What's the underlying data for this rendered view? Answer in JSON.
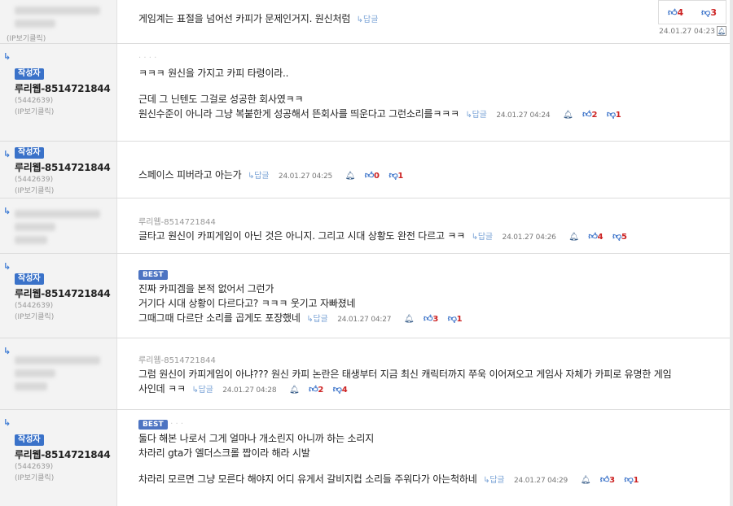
{
  "rows": [
    {
      "ip_label": "(IP보기클릭)",
      "text": "게임계는 표절을 넘어선 카피가 문제인거지. 원신처럼",
      "reply_label": "↳답글",
      "up": "4",
      "down": "3",
      "time": "24.01.27 04:23"
    },
    {
      "badge": "작성자",
      "name": "루리웹-8514721844",
      "uid": "(5442639)",
      "ip_label": "(IP보기클릭)",
      "lines": [
        "ㅋㅋㅋ 원신을 가지고 카피 타령이라..",
        "",
        "근데 그 닌텐도 그걸로 성공한 회사였ㅋㅋ",
        "원신수준이 아니라 그냥 복붙한게 성공해서 뜬회사를 띄운다고 그런소리를ㅋㅋㅋ"
      ],
      "reply_label": "↳답글",
      "time": "24.01.27 04:24",
      "up": "2",
      "down": "1"
    },
    {
      "badge": "작성자",
      "name": "루리웹-8514721844",
      "uid": "(5442639)",
      "ip_label": "(IP보기클릭)",
      "lines": [
        "스페이스 피버라고 아는가"
      ],
      "reply_label": "↳답글",
      "time": "24.01.27 04:25",
      "up": "0",
      "down": "1"
    },
    {
      "quote": "루리웹-8514721844",
      "lines": [
        "글타고 원신이 카피게임이 아닌 것은 아니지. 그리고 시대 상황도 완전 다르고 ㅋㅋ"
      ],
      "reply_label": "↳답글",
      "time": "24.01.27 04:26",
      "up": "4",
      "down": "5"
    },
    {
      "badge": "작성자",
      "name": "루리웹-8514721844",
      "uid": "(5442639)",
      "ip_label": "(IP보기클릭)",
      "best": "BEST",
      "lines": [
        "진짜 카피겜을 본적 없어서 그런가",
        "거기다 시대 상황이 다르다고? ㅋㅋㅋ 웃기고 자빠졌네",
        "그때그때 다르단 소리를 곱게도 포장했네"
      ],
      "reply_label": "↳답글",
      "time": "24.01.27 04:27",
      "up": "3",
      "down": "1"
    },
    {
      "quote": "루리웹-8514721844",
      "lines": [
        "그럼 원신이 카피게임이 아냐??? 원신 카피 논란은 태생부터 지금 최신 캐릭터까지 쭈욱 이어져오고 게임사 자체가 카피로 유명한 게임",
        "사인데 ㅋㅋ"
      ],
      "reply_label": "↳답글",
      "time": "24.01.27 04:28",
      "up": "2",
      "down": "4"
    },
    {
      "badge": "작성자",
      "name": "루리웹-8514721844",
      "uid": "(5442639)",
      "ip_label": "(IP보기클릭)",
      "best": "BEST",
      "lines": [
        "둘다 해본 나로서 그게 얼마나 개소린지 아니까 하는 소리지",
        "차라리 gta가 엘더스크롤 짭이라 해라 시발",
        "",
        "차라리 모르면 그냥 모른다 해야지 어디 유게서 갈비지컵 소리들 주워다가 아는척하네"
      ],
      "reply_label": "↳답글",
      "time": "24.01.27 04:29",
      "up": "3",
      "down": "1"
    }
  ]
}
